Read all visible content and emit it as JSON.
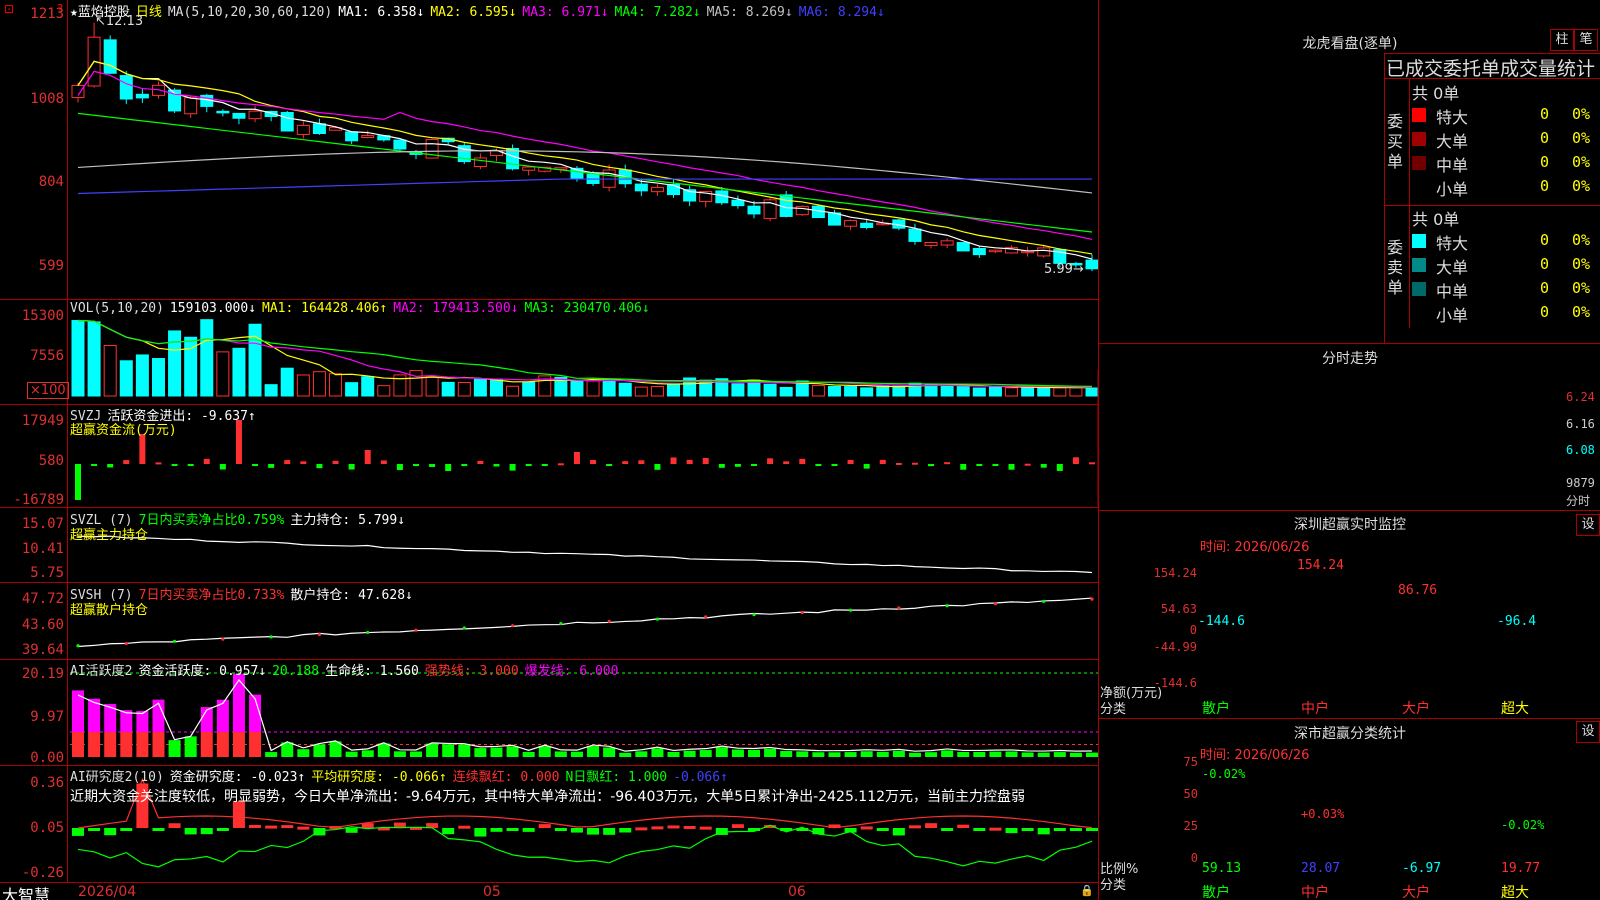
{
  "brand": "大智慧",
  "stock": {
    "name": "★蓝焰控股",
    "period": "日线"
  },
  "price_axis": [
    "1213",
    "1008",
    "804",
    "599"
  ],
  "price_legend": {
    "ma_label": "MA(5,10,20,30,60,120)",
    "ma1": "MA1: 6.358↓",
    "ma2": "MA2: 6.595↓",
    "ma3": "MA3: 6.971↓",
    "ma4": "MA4: 7.282↓",
    "ma5": "MA5: 8.269↓",
    "ma6": "MA6: 8.294↓"
  },
  "price_marks": {
    "high": "12.13",
    "low": "5.99"
  },
  "vol": {
    "legend": "VOL(5,10,20)",
    "v": "159103.000↓",
    "ma1": "MA1: 164428.406↑",
    "ma2": "MA2: 179413.500↓",
    "ma3": "MA3: 230470.406↓",
    "axis": [
      "15300",
      "7556",
      "×100"
    ]
  },
  "svzj": {
    "title": "SVZJ",
    "desc": "活跃资金进出: -9.637↑",
    "sub": "超赢资金流(万元)",
    "axis": [
      "17949",
      "580",
      "-16789"
    ]
  },
  "svzl": {
    "title": "SVZL (7)",
    "desc1": "7日内买卖净占比0.759%",
    "desc2": "主力持仓: 5.799↓",
    "sub": "超赢主力持仓",
    "axis": [
      "15.07",
      "10.41",
      "5.75"
    ]
  },
  "svsh": {
    "title": "SVSH (7)",
    "desc1": "7日内买卖净占比0.733%",
    "desc2": "散户持仓: 47.628↓",
    "sub": "超赢散户持仓",
    "axis": [
      "47.72",
      "43.60",
      "39.64"
    ]
  },
  "ai1": {
    "title": "AI活跃度2",
    "a": "资金活跃度: 0.957↓",
    "b": "20.188",
    "c": "生命线: 1.560",
    "d": "强势线: 3.000",
    "e": "爆发线: 6.000",
    "axis": [
      "20.19",
      "9.97",
      "0.00"
    ]
  },
  "ai2": {
    "title": "AI研究度2(10)",
    "a": "资金研究度: -0.023↑",
    "b": "平均研究度: -0.066↑",
    "c": "连续飘红: 0.000",
    "d": "N日飘红: 1.000",
    "e": "-0.066↑",
    "comment": "近期大资金关注度较低，明显弱势，今日大单净流出：-9.64万元，其中特大单净流出：-96.403万元，大单5日累计净出-2425.112万元，当前主力控盘弱",
    "axis": [
      "0.36",
      "0.05",
      "-0.26"
    ]
  },
  "dates": [
    "2026/04",
    "05",
    "06"
  ],
  "lhb": {
    "title": "龙虎看盘(逐单)",
    "btn1": "柱",
    "btn2": "笔",
    "header": "已成交委托单成交量统计",
    "buy_label": "委买单",
    "sell_label": "委卖单",
    "buy_total": "共 0单",
    "sell_total": "共 0单",
    "buy_rows": [
      {
        "name": "特大",
        "n": "0",
        "p": "0%",
        "color": "#ff0000"
      },
      {
        "name": "大单",
        "n": "0",
        "p": "0%",
        "color": "#a00000"
      },
      {
        "name": "中单",
        "n": "0",
        "p": "0%",
        "color": "#700000"
      },
      {
        "name": "小单",
        "n": "0",
        "p": "0%",
        "color": ""
      }
    ],
    "sell_rows": [
      {
        "name": "特大",
        "n": "0",
        "p": "0%",
        "color": "#00ffff"
      },
      {
        "name": "大单",
        "n": "0",
        "p": "0%",
        "color": "#008a8a"
      },
      {
        "name": "中单",
        "n": "0",
        "p": "0%",
        "color": "#006a6a"
      },
      {
        "name": "小单",
        "n": "0",
        "p": "0%",
        "color": ""
      }
    ]
  },
  "intraday": {
    "title": "分时走势",
    "axis": [
      "6.24",
      "6.16",
      "6.08",
      "9879"
    ],
    "vol_label": "分时"
  },
  "sz_monitor": {
    "title": "深圳超赢实时监控",
    "btn": "设",
    "time": "时间: 2026/06/26",
    "axis": [
      "154.24",
      "54.63",
      "0",
      "-44.99",
      "-144.6"
    ],
    "ylabel": "净额(万元)",
    "xlabel": "分类",
    "chart_data": {
      "type": "bar",
      "categories": [
        "散户",
        "中户",
        "大户",
        "超大"
      ],
      "values": [
        -144.6,
        154.24,
        86.76,
        -96.4
      ],
      "labels": [
        "-144.6",
        "154.24",
        "86.76",
        "-96.4"
      ],
      "ylim": [
        -144.6,
        154.24
      ]
    }
  },
  "sz_class": {
    "title": "深市超赢分类统计",
    "btn": "设",
    "time": "时间: 2026/06/26",
    "axis": [
      "75",
      "50",
      "25",
      "0"
    ],
    "ylabel": "比例%",
    "xlabel": "分类",
    "chart_data": {
      "type": "bar",
      "categories": [
        "散户",
        "中户",
        "大户",
        "超大"
      ],
      "values": [
        59.13,
        28.07,
        -6.97,
        19.77
      ],
      "pct": [
        "-0.02%",
        "+0.03%",
        "",
        "-0.02%"
      ],
      "labels": [
        "59.13",
        "28.07",
        "-6.97",
        "19.77"
      ],
      "ylim": [
        0,
        75
      ]
    }
  },
  "colors": {
    "up": "#ff3030",
    "down": "#00ffff",
    "ma1": "#ffffff",
    "ma2": "#ffff00",
    "ma3": "#ff00ff",
    "ma4": "#00ff00",
    "ma5": "#c0c0c0",
    "ma6": "#4040ff"
  }
}
